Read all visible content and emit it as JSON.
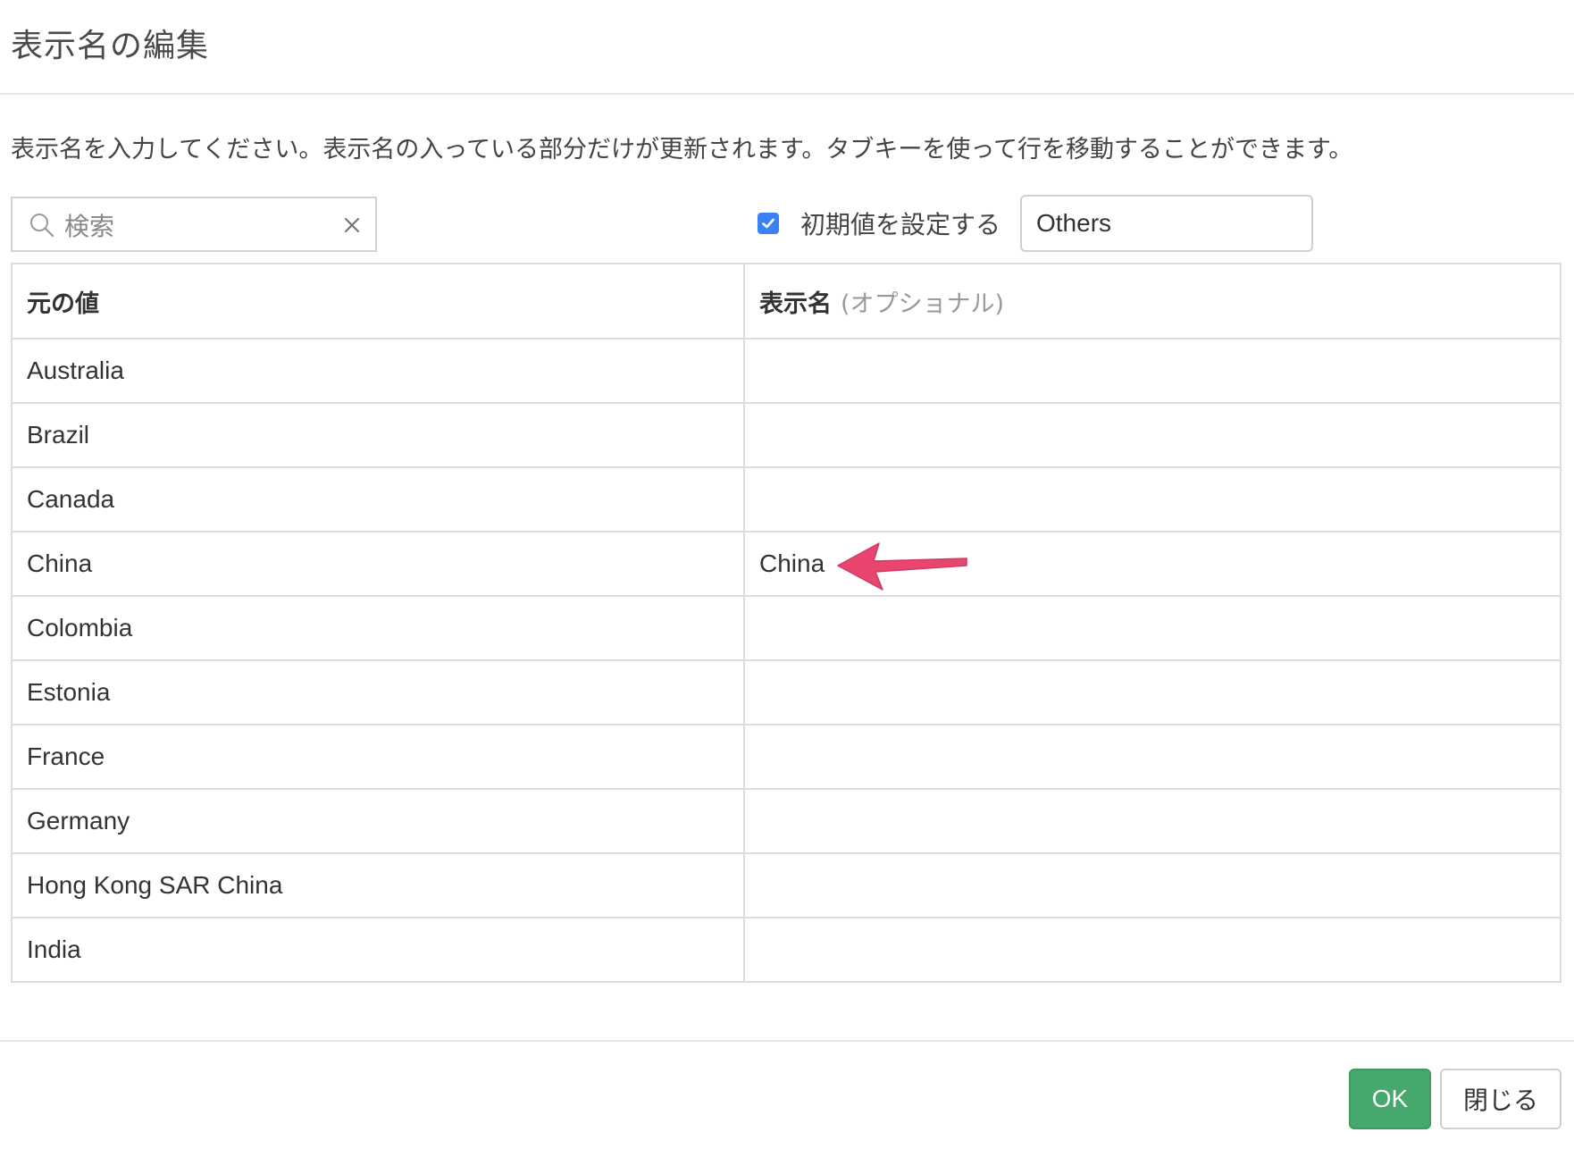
{
  "dialog": {
    "title": "表示名の編集",
    "instructions": "表示名を入力してください。表示名の入っている部分だけが更新されます。タブキーを使って行を移動することができます。"
  },
  "search": {
    "placeholder": "検索",
    "value": ""
  },
  "default_value": {
    "checked": true,
    "label": "初期値を設定する",
    "value": "Others"
  },
  "table": {
    "headers": {
      "original": "元の値",
      "display": "表示名",
      "display_note": "(オプショナル)"
    },
    "rows": [
      {
        "original": "Australia",
        "display": ""
      },
      {
        "original": "Brazil",
        "display": ""
      },
      {
        "original": "Canada",
        "display": ""
      },
      {
        "original": "China",
        "display": "China"
      },
      {
        "original": "Colombia",
        "display": ""
      },
      {
        "original": "Estonia",
        "display": ""
      },
      {
        "original": "France",
        "display": ""
      },
      {
        "original": "Germany",
        "display": ""
      },
      {
        "original": "Hong Kong SAR China",
        "display": ""
      },
      {
        "original": "India",
        "display": ""
      }
    ]
  },
  "buttons": {
    "ok": "OK",
    "close": "閉じる"
  },
  "colors": {
    "ok_button": "#46a86c",
    "checkbox": "#3b82f6",
    "annotation_arrow": "#e8456f"
  }
}
